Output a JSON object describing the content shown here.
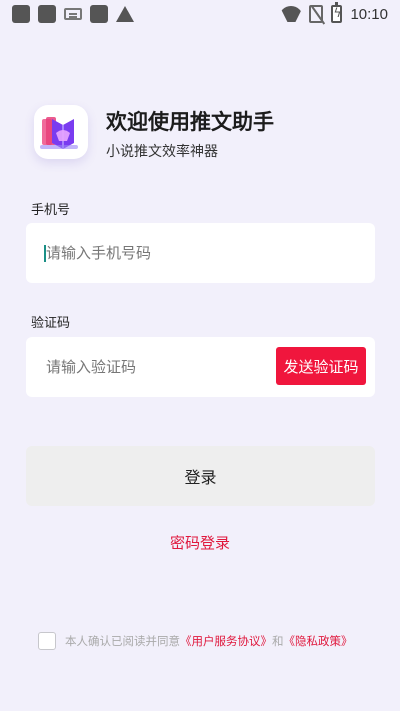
{
  "status_bar": {
    "time": "10:10"
  },
  "header": {
    "title": "欢迎使用推文助手",
    "subtitle": "小说推文效率神器"
  },
  "form": {
    "phone_label": "手机号",
    "phone_placeholder": "请输入手机号码",
    "phone_value": "",
    "code_label": "验证码",
    "code_placeholder": "请输入验证码",
    "code_value": "",
    "send_code_label": "发送验证码",
    "login_label": "登录",
    "password_login_label": "密码登录"
  },
  "agreement": {
    "prefix": "本人确认已阅读并同意",
    "user_agreement": "《用户服务协议》",
    "and": "和",
    "privacy_policy": "《隐私政策》",
    "checked": false
  },
  "colors": {
    "accent": "#f0163d",
    "link": "#e0183d",
    "background": "#f2f0fb"
  }
}
